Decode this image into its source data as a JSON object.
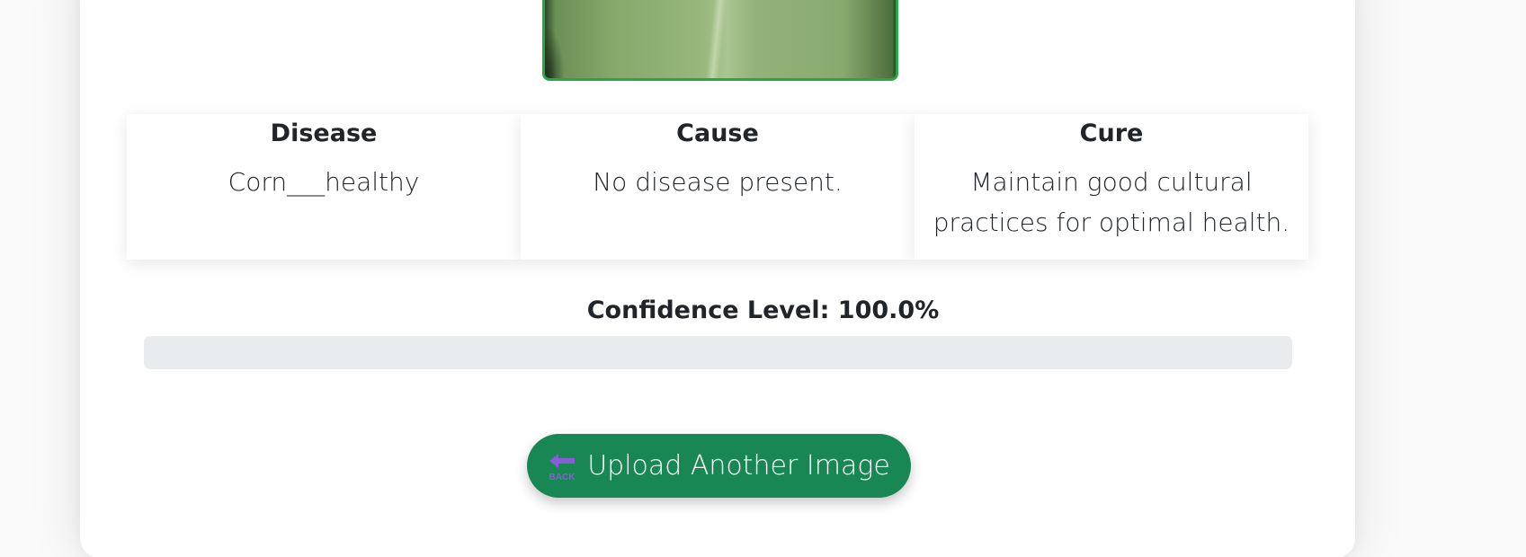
{
  "result": {
    "columns": [
      {
        "title": "Disease",
        "text": "Corn___healthy"
      },
      {
        "title": "Cause",
        "text": "No disease present."
      },
      {
        "title": "Cure",
        "text": "Maintain good cultural practices for optimal health."
      }
    ]
  },
  "confidence": {
    "label": "Confidence Level: 100.0%",
    "value": 1.0
  },
  "upload_button": {
    "label": "Upload Another Image",
    "icon": "back-arrow-icon",
    "icon_text": "BACK"
  },
  "colors": {
    "accent": "#198754",
    "image_border": "#28a745",
    "progress_track": "#e9ecef",
    "icon": "#8a5cd8"
  }
}
